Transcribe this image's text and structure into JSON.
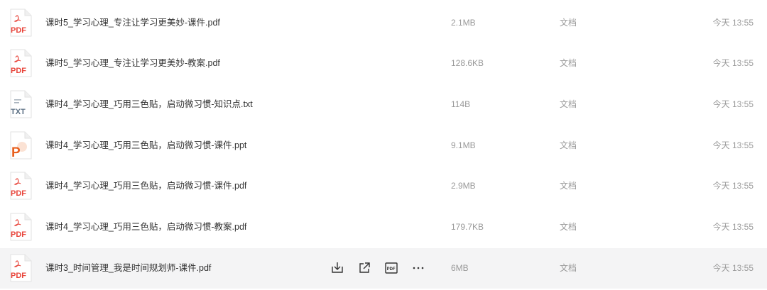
{
  "files": [
    {
      "name": "课时5_学习心理_专注让学习更美妙-课件.pdf",
      "size": "2.1MB",
      "type": "文档",
      "time": "今天 13:55",
      "icon": "pdf-icon",
      "icon_label": "PDF"
    },
    {
      "name": "课时5_学习心理_专注让学习更美妙-教案.pdf",
      "size": "128.6KB",
      "type": "文档",
      "time": "今天 13:55",
      "icon": "pdf-icon",
      "icon_label": "PDF"
    },
    {
      "name": "课时4_学习心理_巧用三色贴，启动微习惯-知识点.txt",
      "size": "114B",
      "type": "文档",
      "time": "今天 13:55",
      "icon": "txt-icon",
      "icon_label": "TXT"
    },
    {
      "name": "课时4_学习心理_巧用三色贴，启动微习惯-课件.ppt",
      "size": "9.1MB",
      "type": "文档",
      "time": "今天 13:55",
      "icon": "ppt-icon",
      "icon_label": "P"
    },
    {
      "name": "课时4_学习心理_巧用三色贴，启动微习惯-课件.pdf",
      "size": "2.9MB",
      "type": "文档",
      "time": "今天 13:55",
      "icon": "pdf-icon",
      "icon_label": "PDF"
    },
    {
      "name": "课时4_学习心理_巧用三色贴，启动微习惯-教案.pdf",
      "size": "179.7KB",
      "type": "文档",
      "time": "今天 13:55",
      "icon": "pdf-icon",
      "icon_label": "PDF"
    },
    {
      "name": "课时3_时间管理_我是时间规划师-课件.pdf",
      "size": "6MB",
      "type": "文档",
      "time": "今天 13:55",
      "icon": "pdf-icon",
      "icon_label": "PDF"
    }
  ],
  "hovered_row_actions": [
    {
      "icon": "download-icon"
    },
    {
      "icon": "share-icon"
    },
    {
      "icon": "pdf-convert-icon",
      "label": "PDF"
    },
    {
      "icon": "more-icon",
      "label": "···"
    }
  ],
  "colors": {
    "pdf": "#e8443a",
    "ppt": "#e8601f",
    "txt": "#5d7185",
    "hover_bg": "#f4f4f5",
    "muted_text": "#9a9a9a",
    "name_text": "#333333"
  }
}
